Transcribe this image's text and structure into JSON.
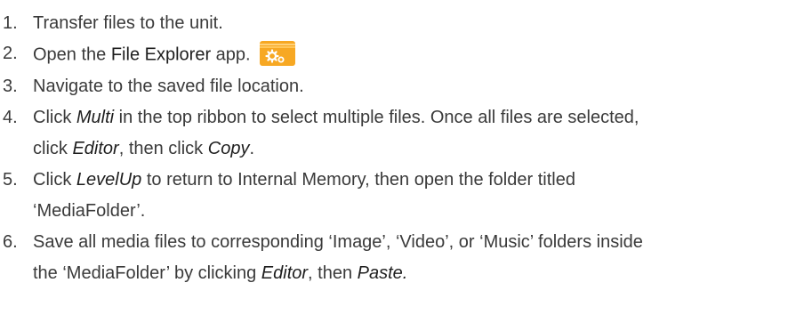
{
  "steps": [
    {
      "number": "1.",
      "text": "Transfer files to the unit."
    },
    {
      "number": "2.",
      "pre": "Open the ",
      "app": "File Explorer",
      "post": " app.",
      "icon": "file-explorer-app-icon",
      "icon_color": "#F7A823"
    },
    {
      "number": "3.",
      "text": "Navigate to the saved file location."
    },
    {
      "number": "4.",
      "a": "Click ",
      "em1": "Multi",
      "b": " in the top ribbon to select multiple files. Once all files are selected,",
      "c": "click ",
      "em2": "Editor",
      "d": ", then click ",
      "em3": "Copy",
      "e": "."
    },
    {
      "number": "5.",
      "a": "Click ",
      "em1": "LevelUp",
      "b": " to return to Internal Memory, then open the folder titled",
      "c": "‘MediaFolder’."
    },
    {
      "number": "6.",
      "a": "Save all media files to corresponding ‘Image’, ‘Video’, or ‘Music’ folders inside",
      "b": "the ‘MediaFolder’ by clicking ",
      "em1": "Editor",
      "c": ", then ",
      "em2": "Paste."
    }
  ]
}
